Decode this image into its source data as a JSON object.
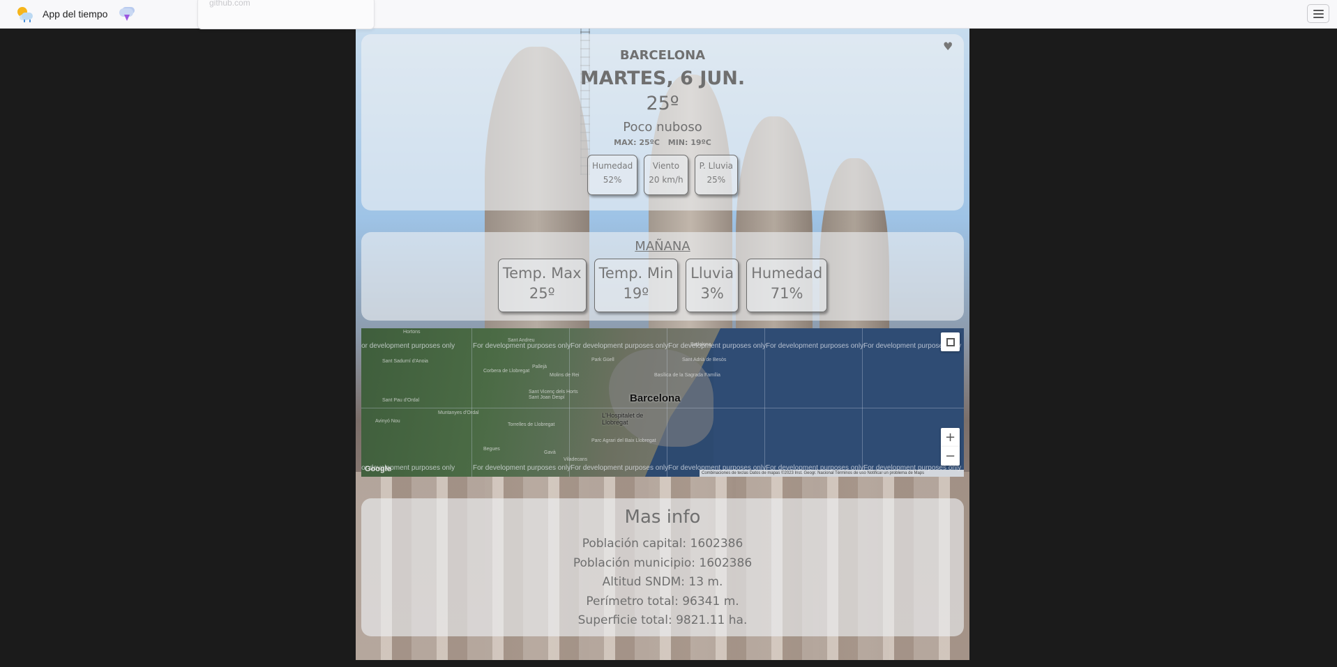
{
  "navbar": {
    "title": "App del tiempo",
    "tooltip_text": "github.com",
    "logo_icon": "sun-cloud-rain-icon",
    "storm_icon": "storm-cloud-icon",
    "menu_icon": "hamburger-icon"
  },
  "current": {
    "city": "BARCELONA",
    "date": "MARTES, 6 JUN.",
    "temperature": "25º",
    "description": "Poco nuboso",
    "max": "MAX: 25ºC",
    "min": "MIN: 19ºC",
    "stats": [
      {
        "label": "Humedad",
        "value": "52%"
      },
      {
        "label": "Viento",
        "value": "20 km/h"
      },
      {
        "label": "P. Lluvia",
        "value": "25%"
      }
    ]
  },
  "tomorrow": {
    "title": "MAÑANA",
    "stats": [
      {
        "label": "Temp. Max",
        "value": "25º"
      },
      {
        "label": "Temp. Min",
        "value": "19º"
      },
      {
        "label": "Lluvia",
        "value": "3%"
      },
      {
        "label": "Humedad",
        "value": "71%"
      }
    ]
  },
  "map": {
    "city_label": "Barcelona",
    "suburb_label": "L'Hospitalet de Llobregat",
    "dev_watermark": "For development purposes only",
    "place_labels": [
      "Sant Andreu",
      "Badalona",
      "Sant Adrià de Besòs",
      "Basílica de la Sagrada Família",
      "Park Güell",
      "Molins de Rei",
      "Sant Joan Despí",
      "Torrelles de Llobregat",
      "Sant Sadurní d'Anoia",
      "Sant Pau d'Ordal",
      "Avinyó Nou",
      "Muntanyes d'Ordal",
      "Corbera de Llobregat",
      "Pallejà",
      "Sant Vicenç dels Horts",
      "Begues",
      "Viladecans",
      "Gavà",
      "Parc Agrari del Baix Llobregat",
      "Hortons"
    ],
    "google_logo": "Google",
    "attribution": "Combinaciones de teclas   Datos de mapas ©2023 Inst. Geogr. Nacional   Términos de uso   Notificar un problema de Maps",
    "fullscreen_icon": "fullscreen-icon",
    "zoom_in": "+",
    "zoom_out": "−"
  },
  "info": {
    "title": "Mas info",
    "items": [
      "Población capital: 1602386",
      "Población municipio: 1602386",
      "Altitud SNDM: 13 m.",
      "Perímetro total: 96341 m.",
      "Superficie total: 9821.11 ha."
    ]
  },
  "colors": {
    "page_background": "#1b1b1b",
    "navbar": "#f8f8fa",
    "card": "rgba(238,240,244,0.62)",
    "text": "#6f6f6f"
  }
}
